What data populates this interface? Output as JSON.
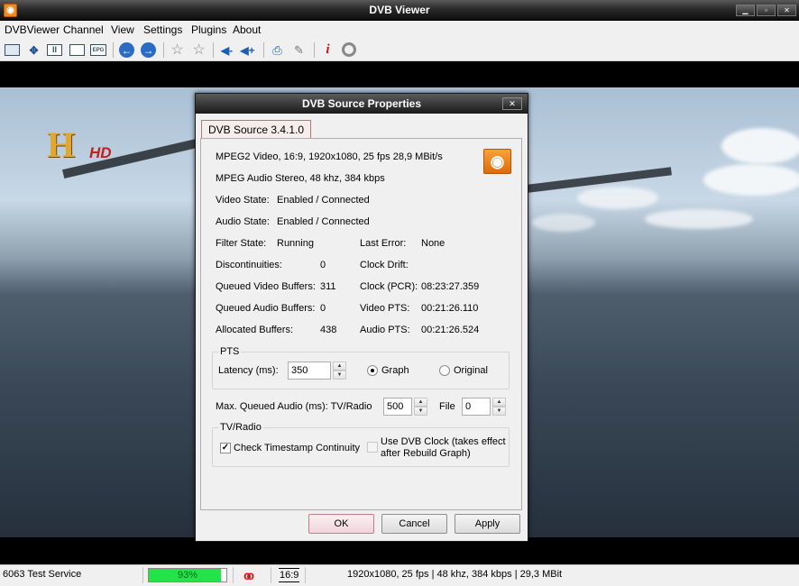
{
  "window": {
    "title": "DVB Viewer",
    "icon": "rss-icon",
    "controls": [
      "minimize-icon",
      "maximize-icon",
      "close-icon"
    ]
  },
  "menu": [
    "DVBViewer",
    "Channel",
    "View",
    "Settings",
    "Plugins",
    "About"
  ],
  "toolbar": {
    "icons": [
      "screen-mode-icon",
      "fullscreen-icon",
      "teletext-icon",
      "osd-icon",
      "epg-icon",
      "back-icon",
      "forward-icon",
      "favorite-icon",
      "favorite-add-icon",
      "volume-down-icon",
      "volume-up-icon",
      "recorder-icon",
      "tools-icon",
      "info-icon",
      "record-status-icon"
    ],
    "epg_label": "EPG"
  },
  "video": {
    "channel_logo": "H",
    "channel_logo_hd": "HD"
  },
  "dialog": {
    "title": "DVB Source Properties",
    "tab": "DVB Source 3.4.1.0",
    "video_info": "MPEG2 Video, 16:9, 1920x1080, 25 fps  28,9 MBit/s",
    "audio_info": "MPEG Audio Stereo, 48 khz, 384 kbps",
    "video_state_label": "Video State:",
    "video_state_value": "Enabled / Connected",
    "audio_state_label": "Audio State:",
    "audio_state_value": "Enabled / Connected",
    "filter_state_label": "Filter State:",
    "filter_state_value": "Running",
    "last_error_label": "Last Error:",
    "last_error_value": "None",
    "discontinuities_label": "Discontinuities:",
    "discontinuities_value": "0",
    "clock_drift_label": "Clock Drift:",
    "clock_drift_value": "",
    "queued_video_label": "Queued Video Buffers:",
    "queued_video_value": "311",
    "clock_pcr_label": "Clock (PCR):",
    "clock_pcr_value": "08:23:27.359",
    "queued_audio_label": "Queued Audio Buffers:",
    "queued_audio_value": "0",
    "video_pts_label": "Video PTS:",
    "video_pts_value": "00:21:26.110",
    "allocated_label": "Allocated Buffers:",
    "allocated_value": "438",
    "audio_pts_label": "Audio PTS:",
    "audio_pts_value": "00:21:26.524",
    "pts_group": {
      "title": "PTS",
      "latency_label": "Latency (ms):",
      "latency_value": "350",
      "option_graph": "Graph",
      "option_original": "Original",
      "selected": "Graph"
    },
    "max_queued_label": "Max. Queued Audio (ms): TV/Radio",
    "max_queued_tv_value": "500",
    "file_label": "File",
    "file_value": "0",
    "tvradio_group": {
      "title": "TV/Radio",
      "check_timestamp_label": "Check Timestamp Continuity",
      "check_timestamp_checked": true,
      "use_dvb_clock_label_1": "Use DVB Clock (takes effect",
      "use_dvb_clock_label_2": "after Rebuild Graph)",
      "use_dvb_clock_checked": false
    },
    "buttons": {
      "ok": "OK",
      "cancel": "Cancel",
      "apply": "Apply"
    }
  },
  "statusbar": {
    "channel": "6063 Test Service",
    "signal_percent": 93,
    "signal_label": "93%",
    "aspect": "16:9",
    "stream_info": "1920x1080, 25 fps | 48 khz, 384 kbps | 29,3 MBit",
    "signal_color": "#22e34a",
    "record_icon": "record-icon"
  }
}
